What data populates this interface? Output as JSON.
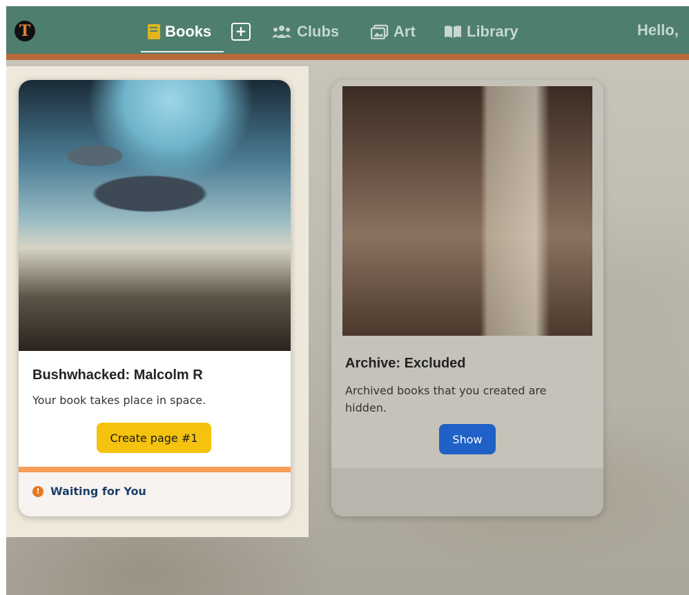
{
  "nav": {
    "logo_letter": "T",
    "items": [
      {
        "label": "Books",
        "icon": "book-icon",
        "active": true
      },
      {
        "label": "Clubs",
        "icon": "users-icon"
      },
      {
        "label": "Art",
        "icon": "images-icon"
      },
      {
        "label": "Library",
        "icon": "book-open-icon"
      }
    ],
    "add_label": "+",
    "greeting": "Hello,"
  },
  "cards": [
    {
      "title": "Bushwhacked: Malcolm R",
      "description": "Your book takes place in space.",
      "button_label": "Create page #1",
      "status_icon": "!",
      "status_label": "Waiting for You"
    },
    {
      "title": "Archive: Excluded",
      "description": "Archived books that you created are hidden.",
      "button_label": "Show"
    }
  ],
  "colors": {
    "navbar": "#4e7e6e",
    "accent_orange": "#b8693a",
    "create_button": "#f4c20f",
    "show_button": "#1f61c6",
    "status_text": "#1d3d6a"
  }
}
